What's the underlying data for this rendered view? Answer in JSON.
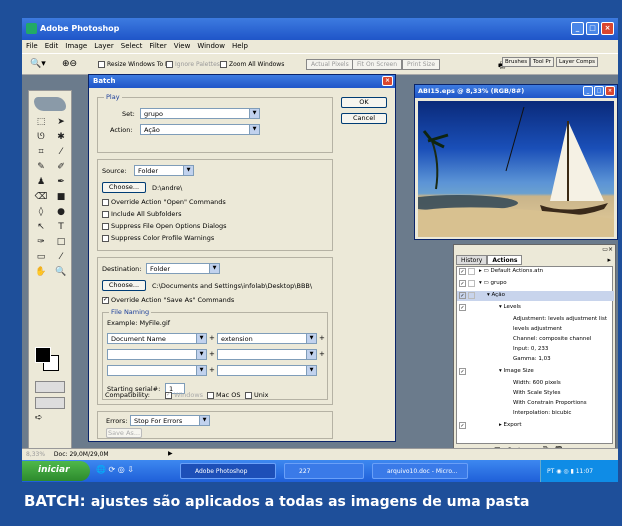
{
  "app": {
    "title": "Adobe Photoshop"
  },
  "menubar": [
    "File",
    "Edit",
    "Image",
    "Layer",
    "Select",
    "Filter",
    "View",
    "Window",
    "Help"
  ],
  "options_bar": {
    "resize_windows": "Resize Windows To Fit",
    "ignore_palettes": "Ignore Palettes",
    "zoom_all": "Zoom All Windows",
    "actual_pixels": "Actual Pixels",
    "fit_on_screen": "Fit On Screen",
    "print_size": "Print Size"
  },
  "palette_well": [
    "Brushes",
    "Tool Pr",
    "Layer Comps"
  ],
  "dialog": {
    "title": "Batch",
    "ok": "OK",
    "cancel": "Cancel",
    "play": {
      "label": "Play",
      "set_label": "Set:",
      "set_value": "grupo",
      "action_label": "Action:",
      "action_value": "Ação"
    },
    "source": {
      "label": "Source:",
      "value": "Folder",
      "choose": "Choose...",
      "path": "D:\\andre\\",
      "opt1": "Override Action \"Open\" Commands",
      "opt2": "Include All Subfolders",
      "opt3": "Suppress File Open Options Dialogs",
      "opt4": "Suppress Color Profile Warnings"
    },
    "destination": {
      "label": "Destination:",
      "value": "Folder",
      "choose": "Choose...",
      "path": "C:\\Documents and Settings\\infolab\\Desktop\\BBB\\",
      "override": "Override Action \"Save As\" Commands",
      "file_naming": "File Naming",
      "example": "Example: MyFile.gif",
      "f1": "Document Name",
      "f2": "extension",
      "serial_label": "Starting serial#:",
      "serial_value": "1",
      "compat_label": "Compatibility:",
      "windows": "Windows",
      "macos": "Mac OS",
      "unix": "Unix"
    },
    "errors": {
      "label": "Errors:",
      "value": "Stop For Errors",
      "save_as": "Save As..."
    }
  },
  "image_window": {
    "title": "ABI15.eps @ 8,33% (RGB/8#)"
  },
  "actions_palette": {
    "tab_history": "History",
    "tab_actions": "Actions",
    "rows": [
      "Default Actions.atn",
      "grupo",
      "Ação",
      "Levels",
      "Adjustment: levels adjustment list",
      "levels adjustment",
      "Channel: composite channel",
      "Input: 0, 233",
      "Gamma: 1,03",
      "Image Size",
      "Width: 600 pixels",
      "With Scale Styles",
      "With Constrain Proportions",
      "Interpolation: bicubic",
      "Export"
    ]
  },
  "status": {
    "zoom": "8,33%",
    "doc": "Doc: 29,0M/29,0M"
  },
  "taskbar": {
    "start": "iniciar",
    "tasks": [
      "Adobe Photoshop",
      "227",
      "arquivo10.doc - Micro..."
    ],
    "tray": "PT",
    "clock": "11:07"
  },
  "caption": {
    "lead": "BATCH:",
    "rest": "ajustes são aplicados a todas as imagens de uma pasta"
  }
}
